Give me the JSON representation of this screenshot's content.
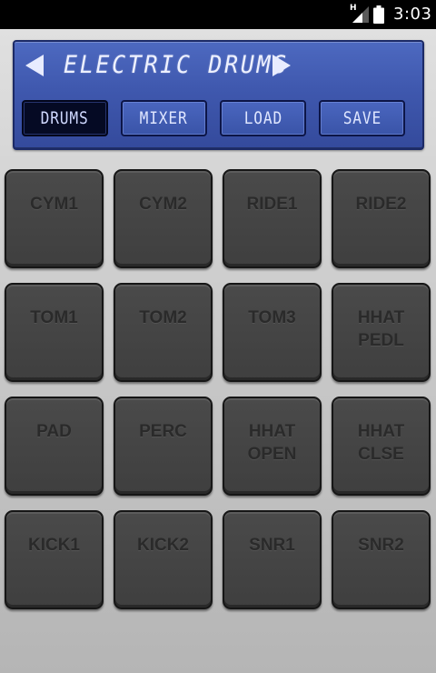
{
  "status_bar": {
    "network_letter": "H",
    "time": "3:03",
    "icons": [
      "signal-icon",
      "battery-icon"
    ]
  },
  "header": {
    "kit_name": "ELECTRIC DRUMS",
    "prev_icon": "left-arrow-icon",
    "next_icon": "right-arrow-icon",
    "tabs": [
      {
        "label": "DRUMS",
        "active": true
      },
      {
        "label": "MIXER",
        "active": false
      },
      {
        "label": "LOAD",
        "active": false
      },
      {
        "label": "SAVE",
        "active": false
      }
    ]
  },
  "pads": [
    {
      "label": "CYM1"
    },
    {
      "label": "CYM2"
    },
    {
      "label": "RIDE1"
    },
    {
      "label": "RIDE2"
    },
    {
      "label": "TOM1"
    },
    {
      "label": "TOM2"
    },
    {
      "label": "TOM3"
    },
    {
      "label": "HHAT\nPEDL"
    },
    {
      "label": "PAD"
    },
    {
      "label": "PERC"
    },
    {
      "label": "HHAT\nOPEN"
    },
    {
      "label": "HHAT\nCLSE"
    },
    {
      "label": "KICK1"
    },
    {
      "label": "KICK2"
    },
    {
      "label": "SNR1"
    },
    {
      "label": "SNR2"
    }
  ],
  "colors": {
    "panel_blue": "#3f58ae",
    "active_tab": "#050a24",
    "pad_gray": "#444444",
    "pad_label": "#2a2a2a"
  }
}
